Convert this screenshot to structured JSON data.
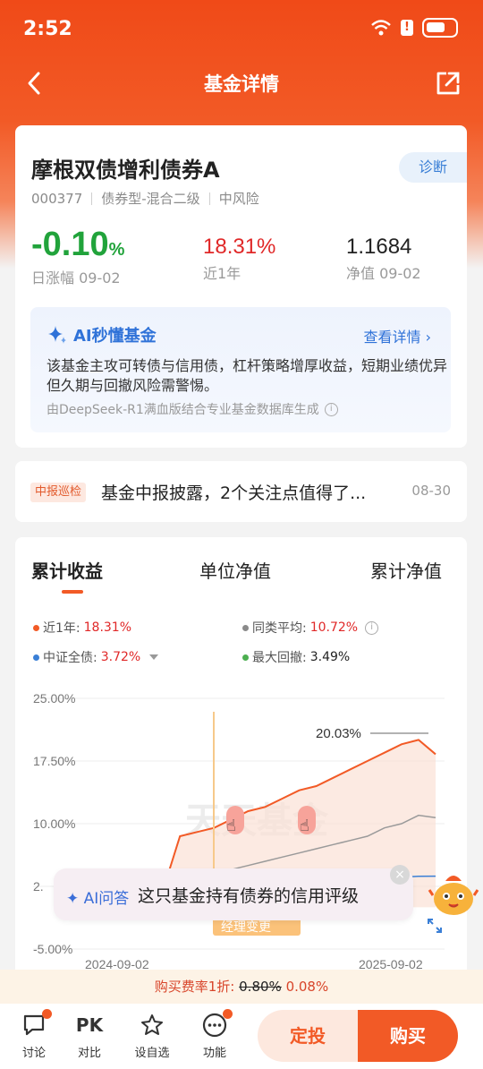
{
  "status": {
    "time": "2:52"
  },
  "nav": {
    "title": "基金详情"
  },
  "fund": {
    "name": "摩根双债增利债券A",
    "diagnose_label": "诊断",
    "code": "000377",
    "type": "债券型-混合二级",
    "risk": "中风险",
    "daily_change": "-0.10",
    "daily_change_unit": "%",
    "daily_change_label": "日涨幅 09-02",
    "year_return": "18.31%",
    "year_return_label": "近1年",
    "nav": "1.1684",
    "nav_label": "净值 09-02"
  },
  "ai_summary": {
    "title": "AI秒懂基金",
    "more": "查看详情",
    "text": "该基金主攻可转债与信用债，杠杆策略增厚收益，短期业绩优异但久期与回撤风险需警惕。",
    "source": "由DeepSeek-R1满血版结合专业基金数据库生成"
  },
  "news": {
    "tag": "中报巡检",
    "text": "基金中报披露，2个关注点值得了...",
    "date": "08-30"
  },
  "chart_tabs": [
    "累计收益",
    "单位净值",
    "累计净值"
  ],
  "legend": {
    "year_label": "近1年:",
    "year_value": "18.31%",
    "peer_label": "同类平均:",
    "peer_value": "10.72%",
    "index_label": "中证全债:",
    "index_value": "3.72%",
    "drawdown_label": "最大回撤:",
    "drawdown_value": "3.49%"
  },
  "colors": {
    "fund": "#f25a26",
    "peer": "#8a8a8a",
    "index": "#3a7fd6",
    "drawdown": "#4caf50"
  },
  "chart_data": {
    "type": "line",
    "title": "",
    "xlabel": "",
    "ylabel": "",
    "y_ticks": [
      "25.00%",
      "17.50%",
      "10.00%",
      "2.",
      "-5.00%"
    ],
    "ylim": [
      -5,
      25
    ],
    "x_ticks": [
      "2024-09-02",
      "2025-09-02"
    ],
    "annotation": "20.03%",
    "watermark": "天天基金",
    "event_label": "经理变更",
    "series": [
      {
        "values": [
          0,
          1.0,
          1.5,
          2.0,
          8.5,
          9.0,
          9.5,
          10.5,
          11.5,
          12.0,
          13.0,
          14.0,
          14.5,
          15.5,
          16.5,
          17.5,
          18.5,
          19.5,
          20.03,
          18.31
        ]
      },
      {
        "values": [
          0,
          0.5,
          1.0,
          1.2,
          2.5,
          3.0,
          3.5,
          4.5,
          5.0,
          5.5,
          6.0,
          6.5,
          7.0,
          7.5,
          8.0,
          8.5,
          9.5,
          10.0,
          11.0,
          10.72
        ]
      },
      {
        "values": [
          0,
          0.4,
          0.8,
          1.0,
          1.3,
          1.6,
          1.9,
          2.1,
          2.3,
          2.5,
          2.7,
          2.9,
          3.0,
          3.1,
          3.3,
          3.4,
          3.5,
          3.6,
          3.7,
          3.72
        ]
      }
    ]
  },
  "ai_prompt": {
    "tag": "AI问答",
    "question": "这只基金持有债券的信用评级"
  },
  "fee": {
    "prefix": "购买费率1折:",
    "original": "0.80%",
    "current": "0.08%"
  },
  "bottom_bar": {
    "discuss": "讨论",
    "compare_icon_text": "PK",
    "compare": "对比",
    "watch": "设自选",
    "features": "功能",
    "dingtou": "定投",
    "buy": "购买"
  }
}
